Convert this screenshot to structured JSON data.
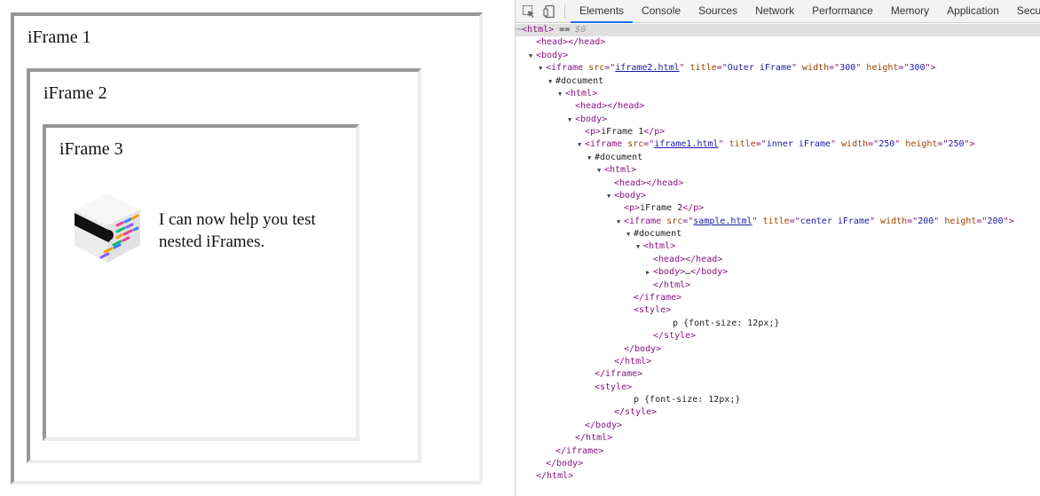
{
  "render": {
    "frames": [
      {
        "title": "iFrame 1"
      },
      {
        "title": "iFrame 2"
      },
      {
        "title": "iFrame 3"
      }
    ],
    "sample_text": "I can now help you test nested iFrames.",
    "logo_icon": "cube-logo-icon"
  },
  "toolbar": {
    "icons": [
      "inspect-element-icon",
      "device-toolbar-icon"
    ],
    "tabs": [
      "Elements",
      "Console",
      "Sources",
      "Network",
      "Performance",
      "Memory",
      "Application",
      "Security"
    ],
    "active_tab": "Elements"
  },
  "colors": {
    "tag": "#881280",
    "attribute": "#994500",
    "value": "#1a1aa6",
    "active_tab": "#1a73e8",
    "frame_border_dark": "#979797",
    "frame_border_light": "#ececec"
  },
  "dom_tree": [
    {
      "indent": 0,
      "parts": [
        [
          "dim",
          "⋯"
        ],
        [
          "tag",
          "<html>"
        ],
        [
          "txt",
          " == "
        ],
        [
          "sel",
          "$0"
        ]
      ],
      "selected": true
    },
    {
      "indent": 1,
      "parts": [
        [
          "tag",
          "<head></head>"
        ]
      ]
    },
    {
      "indent": 1,
      "toggle": "open",
      "parts": [
        [
          "tag",
          "<body>"
        ]
      ]
    },
    {
      "indent": 2,
      "toggle": "open",
      "parts": [
        [
          "tag",
          "<iframe "
        ],
        [
          "attr",
          "src"
        ],
        [
          "tag",
          "=\""
        ],
        [
          "lnk",
          "iframe2.html"
        ],
        [
          "tag",
          "\" "
        ],
        [
          "attr",
          "title"
        ],
        [
          "tag",
          "=\""
        ],
        [
          "val",
          "Outer iFrame"
        ],
        [
          "tag",
          "\" "
        ],
        [
          "attr",
          "width"
        ],
        [
          "tag",
          "=\""
        ],
        [
          "val",
          "300"
        ],
        [
          "tag",
          "\" "
        ],
        [
          "attr",
          "height"
        ],
        [
          "tag",
          "=\""
        ],
        [
          "val",
          "300"
        ],
        [
          "tag",
          "\">"
        ]
      ]
    },
    {
      "indent": 3,
      "toggle": "open",
      "parts": [
        [
          "txt",
          "#document"
        ]
      ]
    },
    {
      "indent": 4,
      "toggle": "open",
      "parts": [
        [
          "tag",
          "<html>"
        ]
      ]
    },
    {
      "indent": 5,
      "parts": [
        [
          "tag",
          "<head></head>"
        ]
      ]
    },
    {
      "indent": 5,
      "toggle": "open",
      "parts": [
        [
          "tag",
          "<body>"
        ]
      ]
    },
    {
      "indent": 6,
      "parts": [
        [
          "tag",
          "<p>"
        ],
        [
          "txt",
          "iFrame 1"
        ],
        [
          "tag",
          "</p>"
        ]
      ]
    },
    {
      "indent": 6,
      "toggle": "open",
      "parts": [
        [
          "tag",
          "<iframe "
        ],
        [
          "attr",
          "src"
        ],
        [
          "tag",
          "=\""
        ],
        [
          "lnk",
          "iframe1.html"
        ],
        [
          "tag",
          "\" "
        ],
        [
          "attr",
          "title"
        ],
        [
          "tag",
          "=\""
        ],
        [
          "val",
          "inner iFrame"
        ],
        [
          "tag",
          "\" "
        ],
        [
          "attr",
          "width"
        ],
        [
          "tag",
          "=\""
        ],
        [
          "val",
          "250"
        ],
        [
          "tag",
          "\" "
        ],
        [
          "attr",
          "height"
        ],
        [
          "tag",
          "=\""
        ],
        [
          "val",
          "250"
        ],
        [
          "tag",
          "\">"
        ]
      ]
    },
    {
      "indent": 7,
      "toggle": "open",
      "parts": [
        [
          "txt",
          "#document"
        ]
      ]
    },
    {
      "indent": 8,
      "toggle": "open",
      "parts": [
        [
          "tag",
          "<html>"
        ]
      ]
    },
    {
      "indent": 9,
      "parts": [
        [
          "tag",
          "<head></head>"
        ]
      ]
    },
    {
      "indent": 9,
      "toggle": "open",
      "parts": [
        [
          "tag",
          "<body>"
        ]
      ]
    },
    {
      "indent": 10,
      "parts": [
        [
          "tag",
          "<p>"
        ],
        [
          "txt",
          "iFrame 2"
        ],
        [
          "tag",
          "</p>"
        ]
      ]
    },
    {
      "indent": 10,
      "toggle": "open",
      "parts": [
        [
          "tag",
          "<iframe "
        ],
        [
          "attr",
          "src"
        ],
        [
          "tag",
          "=\""
        ],
        [
          "lnk",
          "sample.html"
        ],
        [
          "tag",
          "\" "
        ],
        [
          "attr",
          "title"
        ],
        [
          "tag",
          "=\""
        ],
        [
          "val",
          "center iFrame"
        ],
        [
          "tag",
          "\" "
        ],
        [
          "attr",
          "width"
        ],
        [
          "tag",
          "=\""
        ],
        [
          "val",
          "200"
        ],
        [
          "tag",
          "\" "
        ],
        [
          "attr",
          "height"
        ],
        [
          "tag",
          "=\""
        ],
        [
          "val",
          "200"
        ],
        [
          "tag",
          "\">"
        ]
      ]
    },
    {
      "indent": 11,
      "toggle": "open",
      "parts": [
        [
          "txt",
          "#document"
        ]
      ]
    },
    {
      "indent": 12,
      "toggle": "open",
      "parts": [
        [
          "tag",
          "<html>"
        ]
      ]
    },
    {
      "indent": 13,
      "parts": [
        [
          "tag",
          "<head></head>"
        ]
      ]
    },
    {
      "indent": 13,
      "toggle": "closed",
      "parts": [
        [
          "tag",
          "<body>"
        ],
        [
          "txt",
          "…"
        ],
        [
          "tag",
          "</body>"
        ]
      ]
    },
    {
      "indent": 13,
      "parts": [
        [
          "tag",
          "</html>"
        ]
      ]
    },
    {
      "indent": 11,
      "parts": [
        [
          "tag",
          "</iframe>"
        ]
      ]
    },
    {
      "indent": 11,
      "parts": [
        [
          "tag",
          "<style>"
        ]
      ]
    },
    {
      "indent": 15,
      "parts": [
        [
          "txt",
          "p {font-size: 12px;}"
        ]
      ]
    },
    {
      "indent": 13,
      "parts": [
        [
          "tag",
          "</style>"
        ]
      ]
    },
    {
      "indent": 10,
      "parts": [
        [
          "tag",
          "</body>"
        ]
      ]
    },
    {
      "indent": 9,
      "parts": [
        [
          "tag",
          "</html>"
        ]
      ]
    },
    {
      "indent": 7,
      "parts": [
        [
          "tag",
          "</iframe>"
        ]
      ]
    },
    {
      "indent": 7,
      "parts": [
        [
          "tag",
          "<style>"
        ]
      ]
    },
    {
      "indent": 11,
      "parts": [
        [
          "txt",
          "p {font-size: 12px;}"
        ]
      ]
    },
    {
      "indent": 9,
      "parts": [
        [
          "tag",
          "</style>"
        ]
      ]
    },
    {
      "indent": 6,
      "parts": [
        [
          "tag",
          "</body>"
        ]
      ]
    },
    {
      "indent": 5,
      "parts": [
        [
          "tag",
          "</html>"
        ]
      ]
    },
    {
      "indent": 3,
      "parts": [
        [
          "tag",
          "</iframe>"
        ]
      ]
    },
    {
      "indent": 2,
      "parts": [
        [
          "tag",
          "</body>"
        ]
      ]
    },
    {
      "indent": 1,
      "parts": [
        [
          "tag",
          "</html>"
        ]
      ]
    }
  ]
}
